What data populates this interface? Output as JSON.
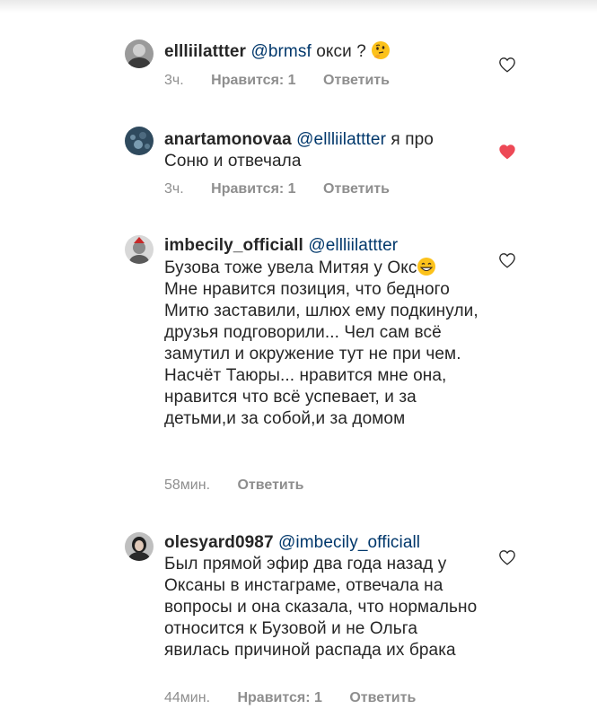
{
  "comments": [
    {
      "username": "ellliilattter",
      "mention": "@brmsf",
      "text": "окси ?",
      "emoji_icon": "thinking-face-emoji",
      "time": "3ч.",
      "likes": "Нравится: 1",
      "reply": "Ответить",
      "liked": false
    },
    {
      "username": "anartamonovaa",
      "mention": "@ellliilattter",
      "text": "я про Соню и отвечала",
      "time": "3ч.",
      "likes": "Нравится: 1",
      "reply": "Ответить",
      "liked": true
    },
    {
      "username": "imbecily_officiall",
      "mention": "@ellliilattter",
      "text": "Бузова тоже увела Митяя у Окс",
      "emoji_icon": "grinning-face-emoji",
      "text2": "Мне нравится позиция, что бедного Митю заставили, шлюх ему подкинули, друзья подговорили... Чел сам всё замутил и окружение тут не при чем. Насчёт Таюры... нравится мне она, нравится что всё успевает, и за детьми,и за собой,и за домом",
      "time": "58мин.",
      "reply": "Ответить",
      "liked": false
    },
    {
      "username": "olesyard0987",
      "mention": "@imbecily_officiall",
      "text": "Был прямой эфир два года назад у Оксаны в инстаграме, отвечала на вопросы и она сказала, что нормально относится к Бузовой и не Ольга явилась причиной распада их брака",
      "time": "44мин.",
      "likes": "Нравится: 1",
      "reply": "Ответить",
      "liked": false
    }
  ],
  "colors": {
    "text": "#262626",
    "mention": "#00376b",
    "meta": "#8e8e8e",
    "heart_liked": "#ed4956"
  }
}
